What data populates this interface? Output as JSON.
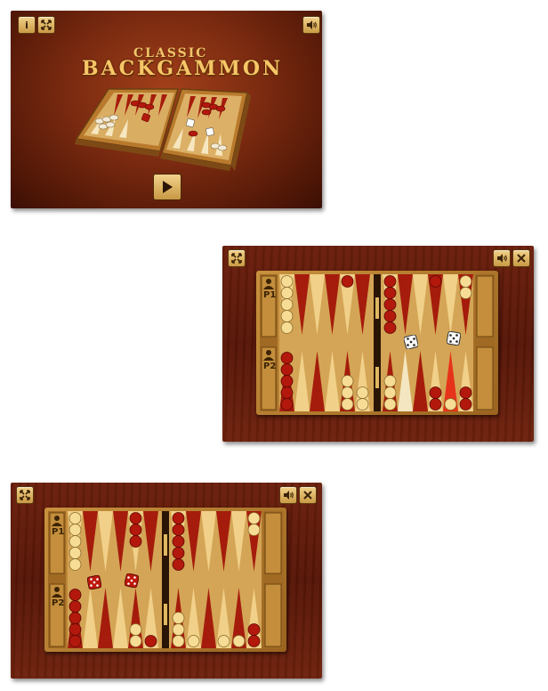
{
  "title_screen": {
    "title_line1": "CLASSIC",
    "title_line2": "BACKGAMMON",
    "info_icon": "info-icon",
    "fullscreen_icon": "fullscreen-icon",
    "sound_icon": "speaker-icon",
    "play_icon": "play-icon"
  },
  "game_screen_1": {
    "player1_label": "P1",
    "player2_label": "P2",
    "dice": [
      5,
      5
    ],
    "icons": [
      "fullscreen-icon",
      "speaker-icon",
      "close-icon"
    ]
  },
  "game_screen_2": {
    "player1_label": "P1",
    "player2_label": "P2",
    "dice": [
      5,
      5
    ],
    "icons": [
      "fullscreen-icon",
      "speaker-icon",
      "close-icon"
    ]
  },
  "colors": {
    "wood_dark": "#4e1606",
    "wood_light": "#a2401a",
    "checker_red": "#b3180c",
    "checker_cream": "#f5dc9a",
    "point_red": "#a51c0c",
    "point_light": "#f3d18e",
    "button_gold": "#e4bb6b"
  }
}
